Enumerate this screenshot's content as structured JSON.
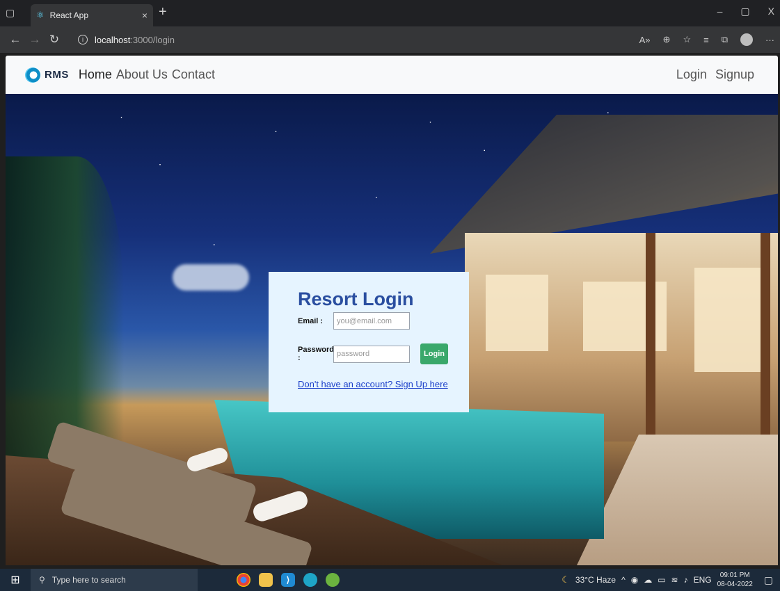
{
  "browser": {
    "tab_title": "React App",
    "tab_close": "×",
    "new_tab": "+",
    "url_host": "localhost",
    "url_path": ":3000/login",
    "window_controls": [
      "–",
      "▢",
      "X"
    ]
  },
  "navbar": {
    "brand": "RMS",
    "links": [
      "Home",
      "About Us",
      "Contact"
    ],
    "right_links": [
      "Login",
      "Signup"
    ]
  },
  "login": {
    "title": "Resort Login",
    "email_label": "Email :",
    "email_placeholder": "you@email.com",
    "password_label": "Password :",
    "password_placeholder": "password",
    "button": "Login",
    "signup_link": "Don't have an account? Sign Up here"
  },
  "taskbar": {
    "search_placeholder": "Type here to search",
    "weather": "33°C Haze",
    "language": "ENG",
    "time": "09:01 PM",
    "date": "08-04-2022"
  },
  "colors": {
    "accent": "#2a4ea0",
    "login_button": "#3aa86b",
    "card_bg": "#e6f4ff"
  }
}
